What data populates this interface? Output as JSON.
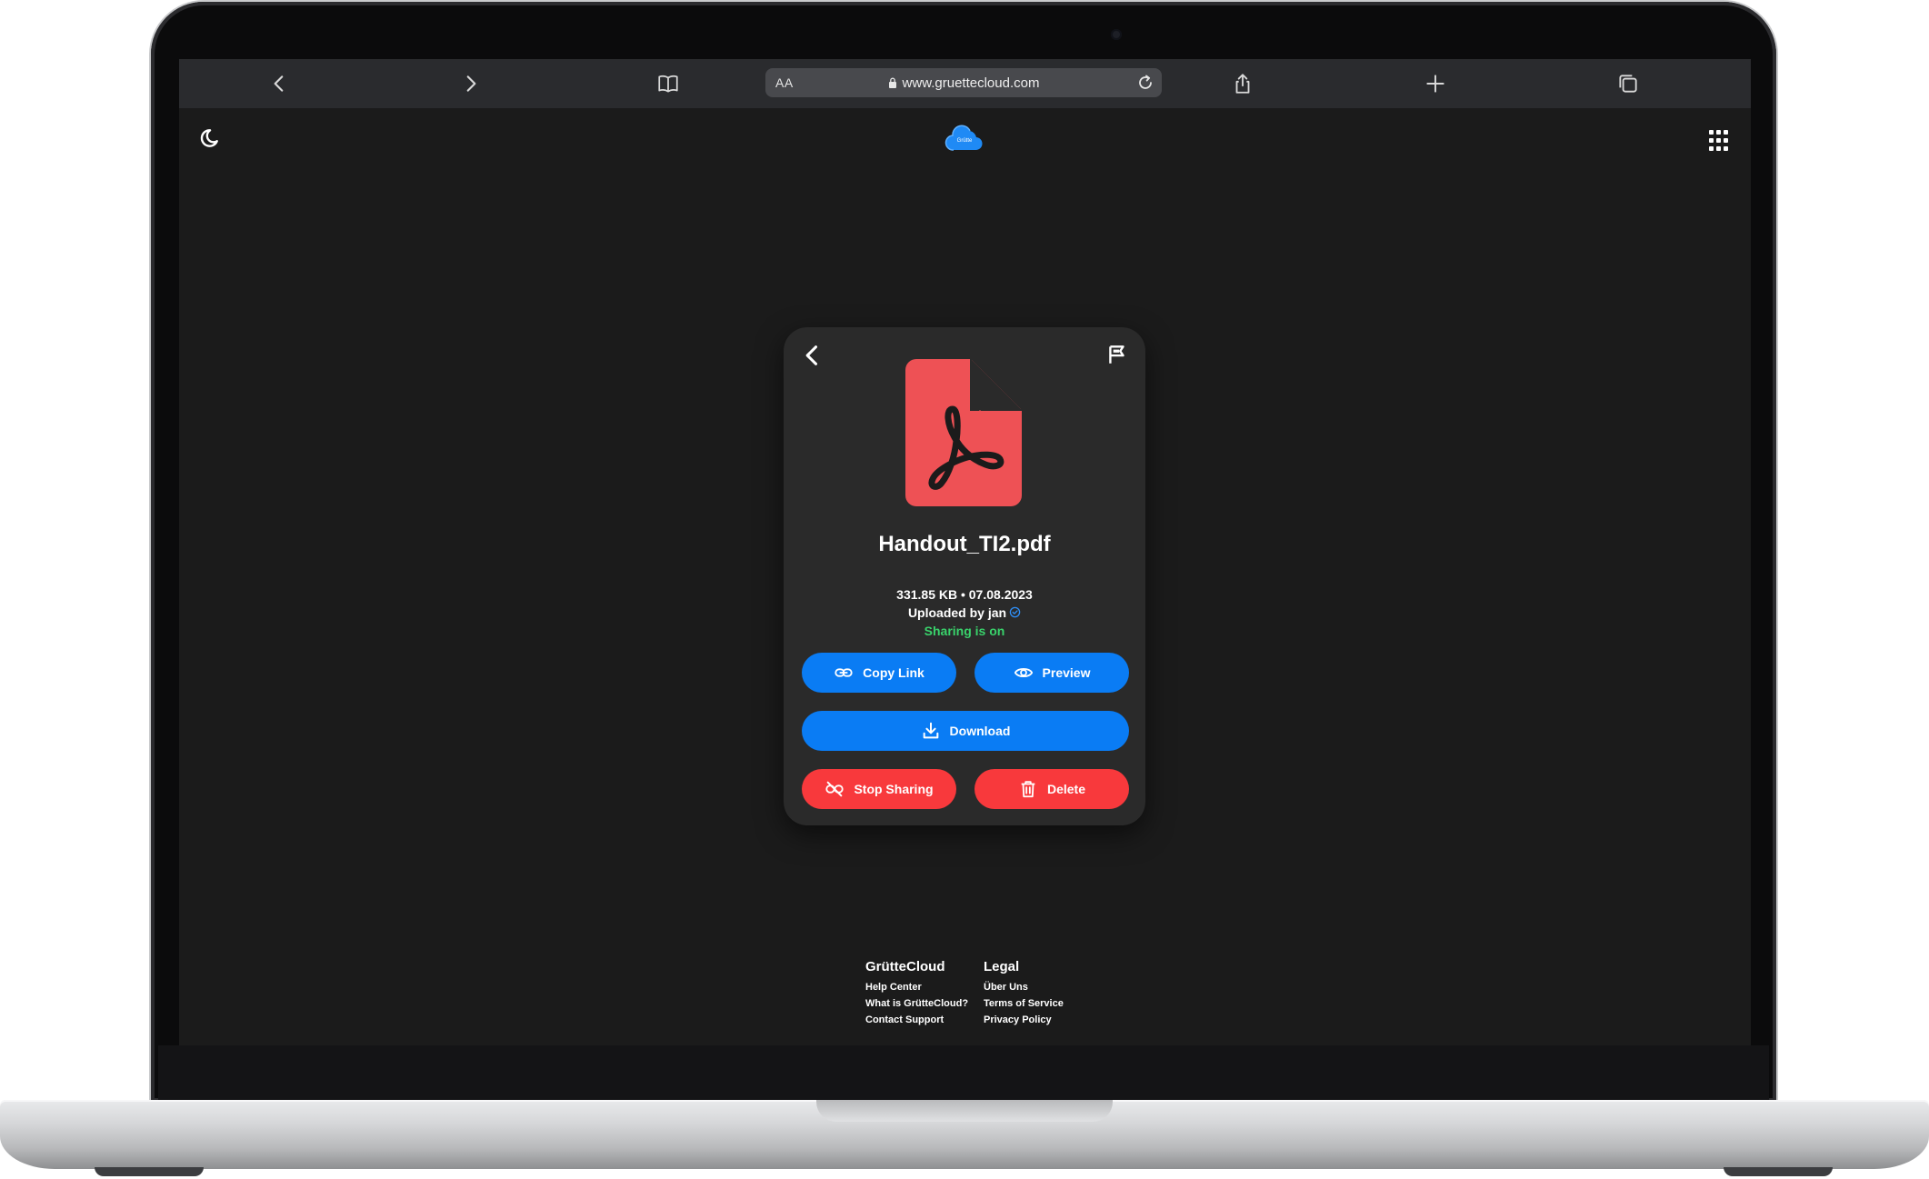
{
  "browser": {
    "aa_label": "AA",
    "url": "www.gruettecloud.com"
  },
  "header": {
    "logo_text": "Grütte"
  },
  "file": {
    "name": "Handout_TI2.pdf",
    "size_date": "331.85 KB • 07.08.2023",
    "uploader": "Uploaded by jan",
    "sharing_status": "Sharing is on",
    "icon": "pdf-document-icon"
  },
  "actions": {
    "copy_link": "Copy Link",
    "preview": "Preview",
    "download": "Download",
    "stop_sharing": "Stop Sharing",
    "delete": "Delete"
  },
  "footer": {
    "col1": {
      "title": "GrütteCloud",
      "links": [
        "Help Center",
        "What is GrütteCloud?",
        "Contact Support"
      ]
    },
    "col2": {
      "title": "Legal",
      "links": [
        "Über Uns",
        "Terms of Service",
        "Privacy Policy"
      ]
    }
  },
  "colors": {
    "primary_blue": "#0a7cf4",
    "danger_red": "#f8393c",
    "success_green": "#39d26b",
    "pdf_red": "#ee5155",
    "background": "#1b1b1b",
    "card": "#2a2a2a"
  }
}
